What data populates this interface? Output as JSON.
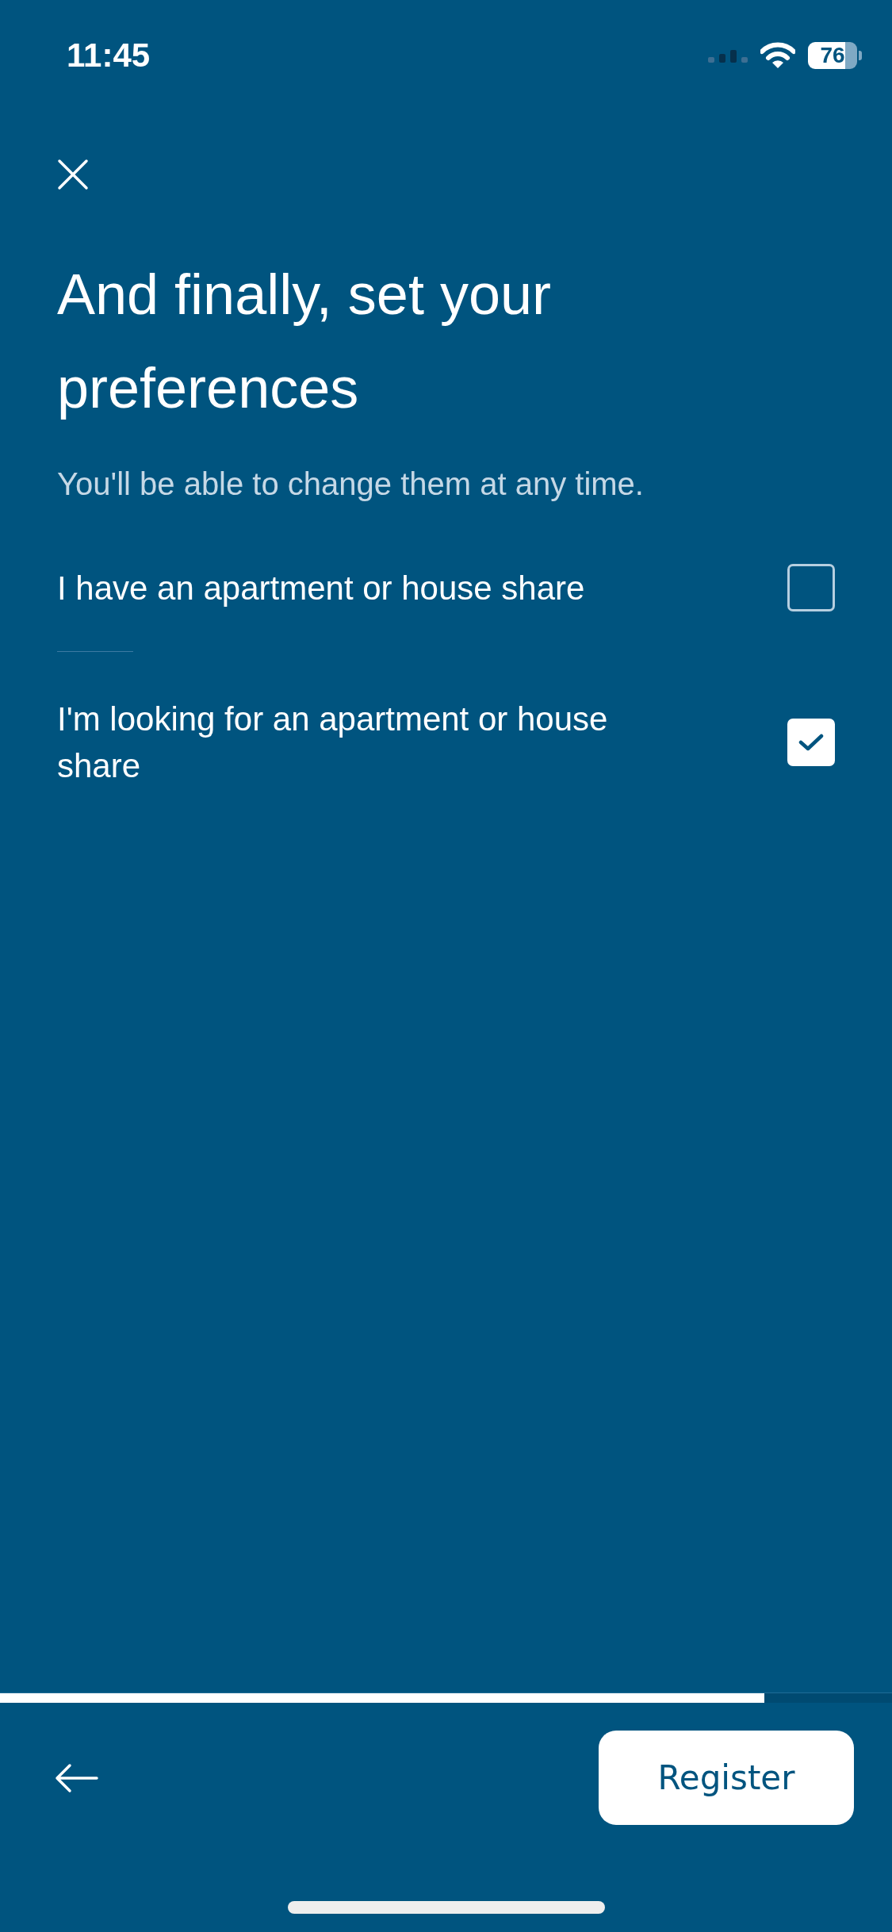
{
  "status_bar": {
    "time": "11:45",
    "battery": "76"
  },
  "title": "And finally, set your preferences",
  "subtitle": "You'll be able to change them at any time.",
  "options": [
    {
      "label": "I have an apartment or house share",
      "checked": false
    },
    {
      "label": "I'm looking for an apartment or house share",
      "checked": true
    }
  ],
  "progress": {
    "level": 0.857
  },
  "footer": {
    "button": "Register"
  }
}
